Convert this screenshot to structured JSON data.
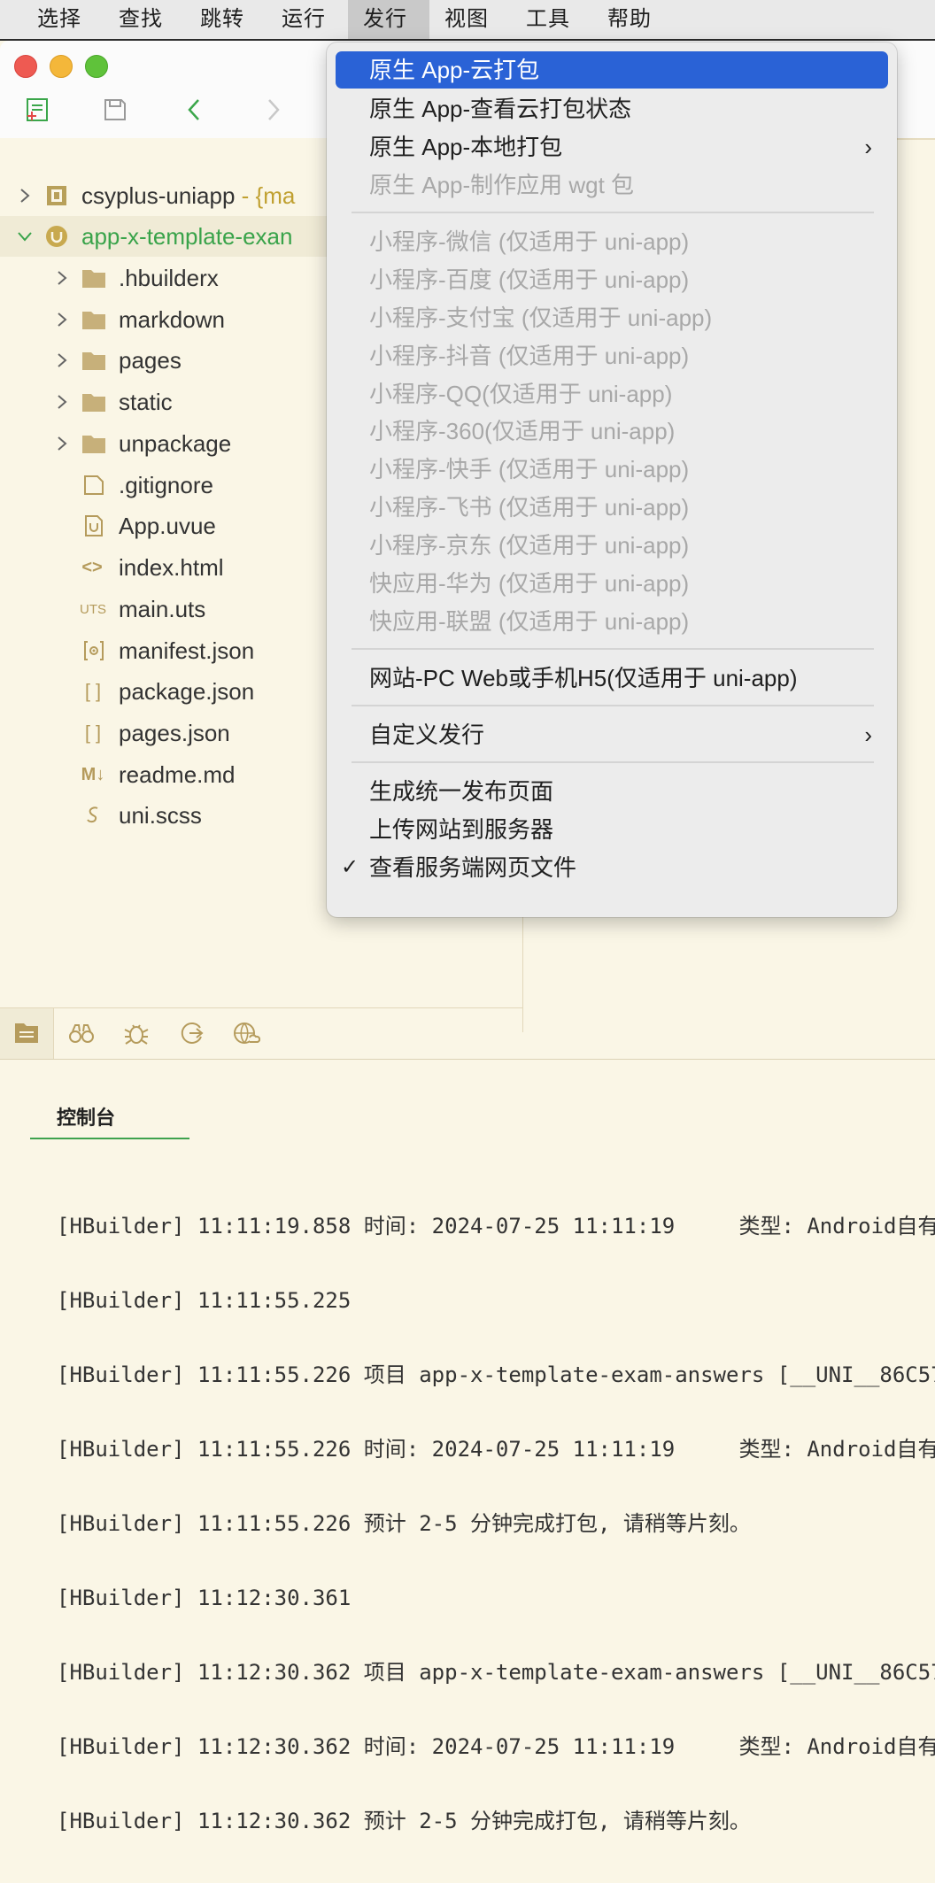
{
  "menubar": {
    "items": [
      "选择",
      "查找",
      "跳转",
      "运行",
      "发行",
      "视图",
      "工具",
      "帮助"
    ],
    "active_index": 4
  },
  "colors": {
    "accent": "#2a62d6",
    "project_green": "#39a34a",
    "background": "#faf6e6"
  },
  "tree": {
    "rows": [
      {
        "name": "csyplus-uniapp",
        "suffix": " - {ma",
        "icon": "project-icon",
        "expanded": false,
        "indent": 0
      },
      {
        "name": "app-x-template-exan",
        "icon": "uniapp-project-icon",
        "expanded": true,
        "indent": 0
      },
      {
        "name": ".hbuilderx",
        "icon": "folder-icon",
        "expanded": false,
        "indent": 1
      },
      {
        "name": "markdown",
        "icon": "folder-icon",
        "expanded": false,
        "indent": 1
      },
      {
        "name": "pages",
        "icon": "folder-icon",
        "expanded": false,
        "indent": 1
      },
      {
        "name": "static",
        "icon": "folder-icon",
        "expanded": false,
        "indent": 1
      },
      {
        "name": "unpackage",
        "icon": "folder-icon",
        "expanded": false,
        "indent": 1
      },
      {
        "name": ".gitignore",
        "icon": "file-icon",
        "indent": 1
      },
      {
        "name": "App.uvue",
        "icon": "uvue-file-icon",
        "indent": 1
      },
      {
        "name": "index.html",
        "icon": "html-file-icon",
        "indent": 1
      },
      {
        "name": "main.uts",
        "icon": "uts-file-icon",
        "indent": 1
      },
      {
        "name": "manifest.json",
        "icon": "manifest-file-icon",
        "indent": 1
      },
      {
        "name": "package.json",
        "icon": "json-file-icon",
        "indent": 1
      },
      {
        "name": "pages.json",
        "icon": "json-file-icon",
        "indent": 1
      },
      {
        "name": "readme.md",
        "icon": "markdown-file-icon",
        "indent": 1
      },
      {
        "name": "uni.scss",
        "icon": "scss-file-icon",
        "indent": 1
      }
    ]
  },
  "icons": {
    "uts_text": "UTS",
    "md_text": "M↓",
    "json_text": "[ ]",
    "html_text": "<>"
  },
  "dropdown": {
    "items": [
      {
        "label": "原生 App-云打包",
        "state": "highlight"
      },
      {
        "label": "原生 App-查看云打包状态",
        "state": "normal"
      },
      {
        "label": "原生 App-本地打包",
        "state": "normal",
        "submenu": true
      },
      {
        "label": "原生 App-制作应用 wgt 包",
        "state": "disabled"
      },
      {
        "separator": true
      },
      {
        "label": "小程序-微信 (仅适用于 uni-app)",
        "state": "disabled"
      },
      {
        "label": "小程序-百度 (仅适用于 uni-app)",
        "state": "disabled"
      },
      {
        "label": "小程序-支付宝 (仅适用于 uni-app)",
        "state": "disabled"
      },
      {
        "label": "小程序-抖音 (仅适用于 uni-app)",
        "state": "disabled"
      },
      {
        "label": "小程序-QQ(仅适用于 uni-app)",
        "state": "disabled"
      },
      {
        "label": "小程序-360(仅适用于 uni-app)",
        "state": "disabled"
      },
      {
        "label": "小程序-快手 (仅适用于 uni-app)",
        "state": "disabled"
      },
      {
        "label": "小程序-飞书 (仅适用于 uni-app)",
        "state": "disabled"
      },
      {
        "label": "小程序-京东 (仅适用于 uni-app)",
        "state": "disabled"
      },
      {
        "label": "快应用-华为 (仅适用于 uni-app)",
        "state": "disabled"
      },
      {
        "label": "快应用-联盟 (仅适用于 uni-app)",
        "state": "disabled"
      },
      {
        "separator": true
      },
      {
        "label": "网站-PC Web或手机H5(仅适用于 uni-app)",
        "state": "normal"
      },
      {
        "separator": true
      },
      {
        "label": "自定义发行",
        "state": "normal",
        "submenu": true
      },
      {
        "separator": true
      },
      {
        "label": "生成统一发布页面",
        "state": "normal"
      },
      {
        "label": "上传网站到服务器",
        "state": "normal"
      },
      {
        "label": "查看服务端网页文件",
        "state": "normal",
        "checked": true
      }
    ],
    "submenu_glyph": "›",
    "check_glyph": "✓"
  },
  "console": {
    "tab_label": "控制台",
    "lines": [
      "[HBuilder] 11:11:19.858 时间: 2024-07-25 11:11:19     类型: Android自有",
      "[HBuilder] 11:11:55.225",
      "[HBuilder] 11:11:55.226 项目 app-x-template-exam-answers [__UNI__86C57",
      "[HBuilder] 11:11:55.226 时间: 2024-07-25 11:11:19     类型: Android自有",
      "[HBuilder] 11:11:55.226 预计 2-5 分钟完成打包, 请稍等片刻。",
      "[HBuilder] 11:12:30.361",
      "[HBuilder] 11:12:30.362 项目 app-x-template-exam-answers [__UNI__86C57",
      "[HBuilder] 11:12:30.362 时间: 2024-07-25 11:11:19     类型: Android自有",
      "[HBuilder] 11:12:30.362 预计 2-5 分钟完成打包, 请稍等片刻。"
    ]
  }
}
